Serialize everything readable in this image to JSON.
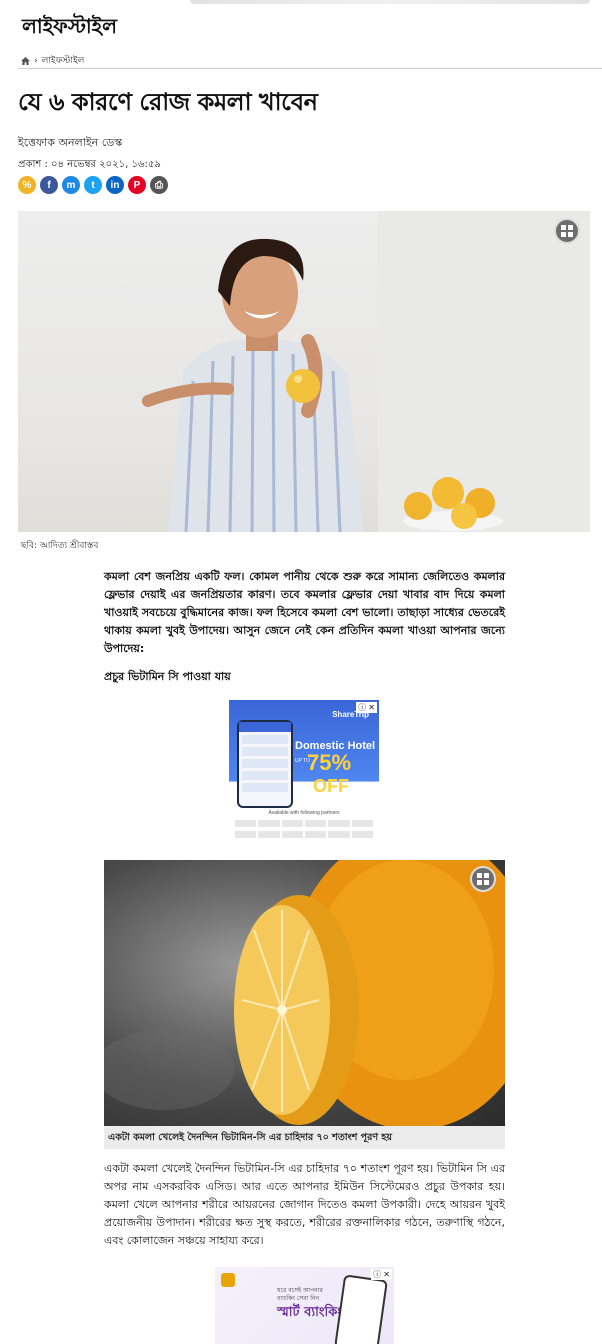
{
  "header": {
    "section_title": "লাইফস্টাইল"
  },
  "breadcrumb": {
    "home_icon": "home-icon",
    "separator": "›",
    "current": "লাইফস্টাইল"
  },
  "article": {
    "headline": "যে ৬ কারণে রোজ কমলা খাবেন",
    "byline": "ইত্তেফাক অনলাইন ডেস্ক",
    "published": "প্রকাশ : ০৪ নভেম্বর ২০২১, ১৬:৫৯",
    "hero_caption": "ছবি: আদিত্য শ্রীবাস্তব",
    "intro": "কমলা বেশ জনপ্রিয় একটি ফল। কোমল পানীয় থেকে শুরু করে সামান্য জেলিতেও কমলার ফ্লেভার দেয়াই এর জনপ্রিয়তার কারণ। তবে কমলার ফ্লেভার দেয়া খাবার বাদ দিয়ে কমলা খাওয়াই সবচেয়ে বুদ্ধিমানের কাজ। ফল হিসেবে কমলা বেশ ভালো। তাছাড়া সাধ্যের ভেতরেই থাকায় কমলা খুবই উপাদেয়। আসুন জেনে নেই কেন প্রতিদিন কমলা খাওয়া আপনার জন্যে উপাদেয়:",
    "subheading_1": "প্রচুর ভিটামিন সি পাওয়া যায়",
    "image2_caption": "একটা কমলা খেলেই দৈনন্দিন ভিটামিন-সি এর চাহিদার ৭০ শতাংশ পূরণ হয়",
    "para_2": "একটা কমলা খেলেই দৈনন্দিন ভিটামিন-সি এর চাহিদার ৭০ শতাংশ পূরণ হয়। ভিটামিন সি এর অপর নাম এসকরবিক এসিড। আর এতে আপনার ইমিউন সিস্টেমেরও প্রচুর উপকার হয়। কমলা খেলে আপনার শরীরে আয়রনের জোগান দিতেও কমলা উপকারী। দেহে আয়রন খুবই প্রয়োজনীয় উপাদান। শরীরের ক্ষত সুস্থ করতে, শরীরের রক্তনালিকার গঠনে, তরুণাস্থি গঠনে, এবং কোলাজেন সঞ্চয়ে সাহায্য করে।"
  },
  "share_icons": [
    {
      "name": "copy-link-icon",
      "color": "#f0b429",
      "glyph": "%"
    },
    {
      "name": "facebook-icon",
      "color": "#3b5998",
      "glyph": "f"
    },
    {
      "name": "messenger-icon",
      "color": "#1e88e5",
      "glyph": "m"
    },
    {
      "name": "twitter-icon",
      "color": "#1da1f2",
      "glyph": "t"
    },
    {
      "name": "linkedin-icon",
      "color": "#0a66c2",
      "glyph": "in"
    },
    {
      "name": "pinterest-icon",
      "color": "#e60023",
      "glyph": "P"
    },
    {
      "name": "print-icon",
      "color": "#555555",
      "glyph": "⎙"
    }
  ],
  "ad_1": {
    "close": "ⓘ ✕",
    "brand": "ShareTrip",
    "headline": "Domestic Hotel",
    "upto": "UP TO",
    "percent": "75%",
    "off": "OFF",
    "partners": "Available with following partners"
  },
  "ad_2": {
    "close": "ⓘ ✕",
    "line_1": "ঘরে বসেই আপনার",
    "line_2": "ব্যাংকিং সেবা নিন",
    "headline": "স্মার্ট ব্যাংকিং"
  },
  "colors": {
    "accent_orange": "#f3a516",
    "rule": "#cfcfcf",
    "caption_bg": "#ececec"
  }
}
